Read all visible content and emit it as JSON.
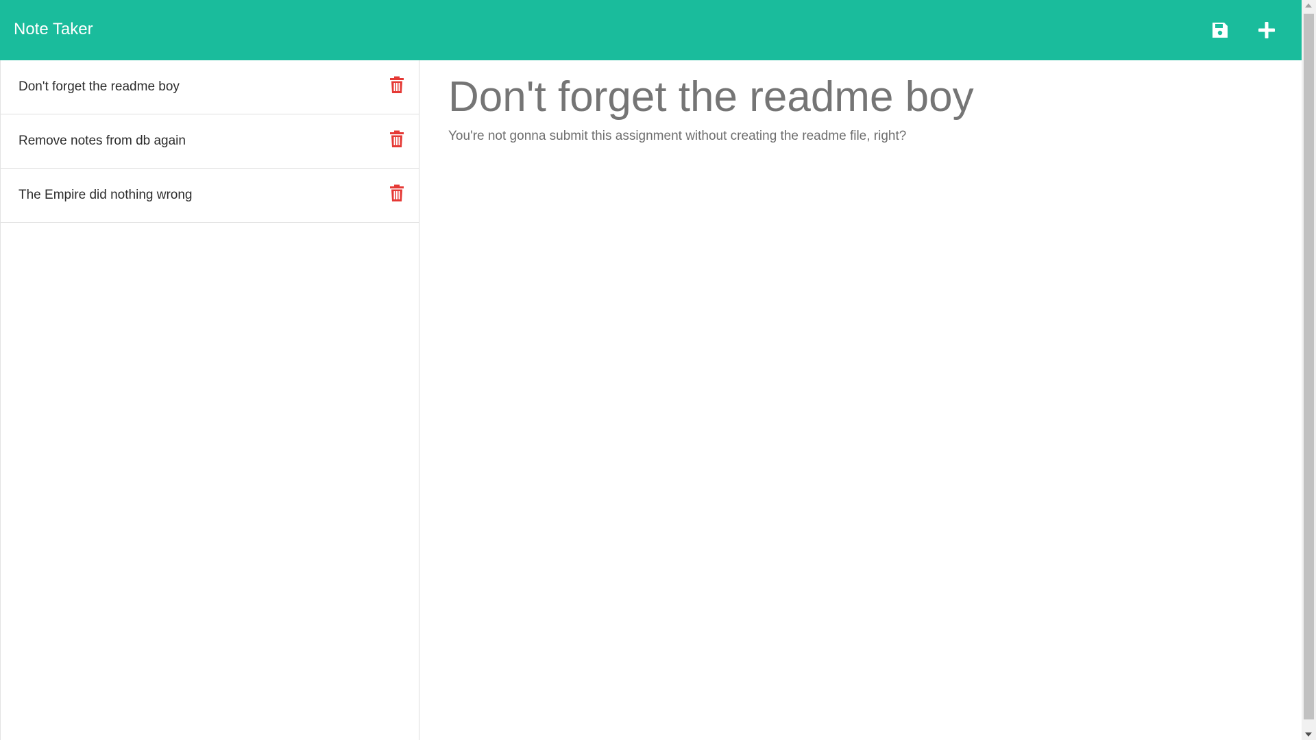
{
  "app": {
    "title": "Note Taker",
    "accent_color": "#1abc9c"
  },
  "toolbar": {
    "save_icon": "floppy-disk-icon",
    "add_icon": "plus-icon"
  },
  "sidebar": {
    "items": [
      {
        "label": "Don't forget the readme boy",
        "delete_icon": "trash-icon"
      },
      {
        "label": "Remove notes from db again",
        "delete_icon": "trash-icon"
      },
      {
        "label": "The Empire did nothing wrong",
        "delete_icon": "trash-icon"
      }
    ],
    "delete_color": "#e53935"
  },
  "main": {
    "note_title": "Don't forget the readme boy",
    "note_text": "You're not gonna submit this assignment without creating the readme file, right?"
  }
}
